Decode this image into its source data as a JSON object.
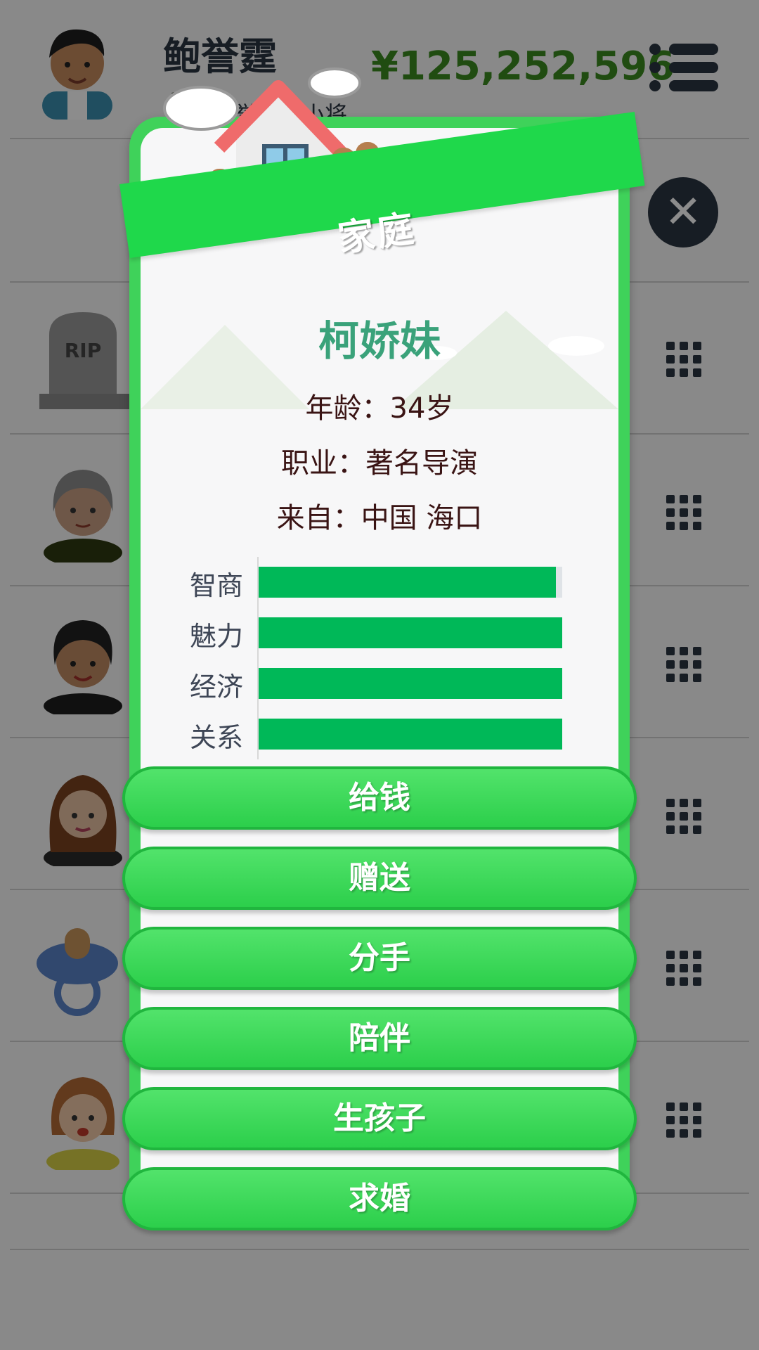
{
  "header": {
    "player_name": "鲍誉霆",
    "money": "¥125,252,596",
    "job_text": "鲍誉霆的小将",
    "menu_icon": "menu-icon"
  },
  "family_rows": [
    {
      "avatar": "gravestone-rip-icon",
      "avatar_text": "RIP"
    },
    {
      "avatar": "grandmother-avatar"
    },
    {
      "avatar": "mother-avatar"
    },
    {
      "avatar": "partner-avatar"
    },
    {
      "avatar": "pacifier-baby-icon"
    },
    {
      "avatar": "daughter-avatar"
    }
  ],
  "modal": {
    "title": "家庭",
    "partner": {
      "name": "柯娇妹",
      "age_label": "年龄：",
      "age_value": "34岁",
      "job_label": "职业：",
      "job_value": "著名导演",
      "from_label": "来自：",
      "from_value": "中国 海口"
    },
    "stats": [
      {
        "label": "智商",
        "value": 0.98
      },
      {
        "label": "魅力",
        "value": 1.0
      },
      {
        "label": "经济",
        "value": 1.0
      },
      {
        "label": "关系",
        "value": 1.0
      }
    ],
    "actions": [
      "给钱",
      "赠送",
      "分手",
      "陪伴",
      "生孩子",
      "求婚"
    ]
  },
  "colors": {
    "accent_green": "#1fd84b",
    "stat_green": "#00b858",
    "name_teal": "#3aa27a",
    "money_green": "#3b8a1f",
    "dark_text": "#2b3542"
  }
}
